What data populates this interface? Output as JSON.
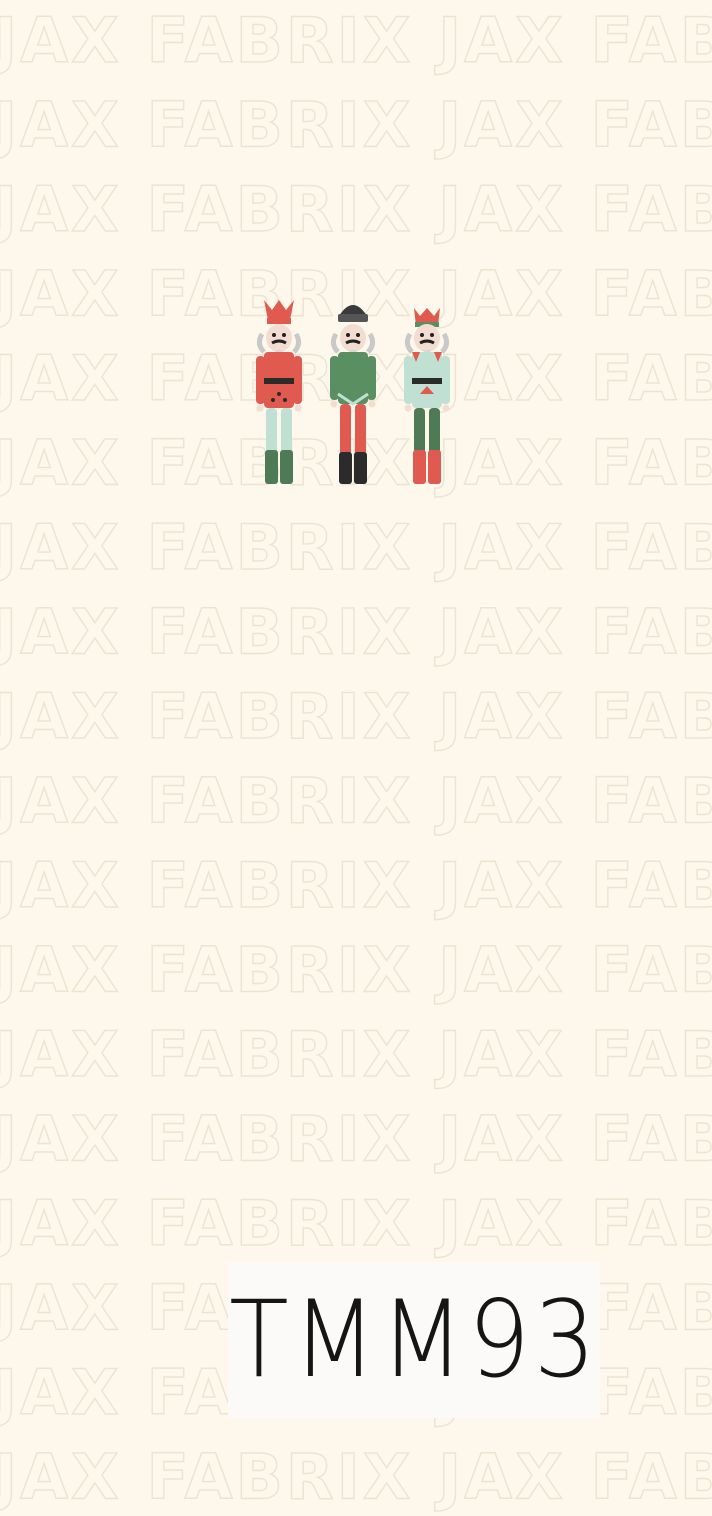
{
  "watermark": {
    "text": "JAX FABRIX",
    "color": "#ece4d2"
  },
  "background_color": "#fdf7ec",
  "artwork": {
    "subject": "nutcracker-soldiers",
    "figures": [
      {
        "name": "nutcracker-red",
        "hat": "crown",
        "jacket_color": "#e05a4f",
        "pants_color": "#bfe0d2",
        "boots_color": "#4e7a55"
      },
      {
        "name": "nutcracker-green",
        "hat": "black-hat",
        "jacket_color": "#5a8f62",
        "pants_color": "#e05a4f",
        "boots_color": "#2b2b2b"
      },
      {
        "name": "nutcracker-mint",
        "hat": "crown",
        "jacket_color": "#bfe0d2",
        "pants_color": "#4e7a55",
        "boots_color": "#e05a4f"
      }
    ]
  },
  "code_label": {
    "text": "TMM93"
  }
}
